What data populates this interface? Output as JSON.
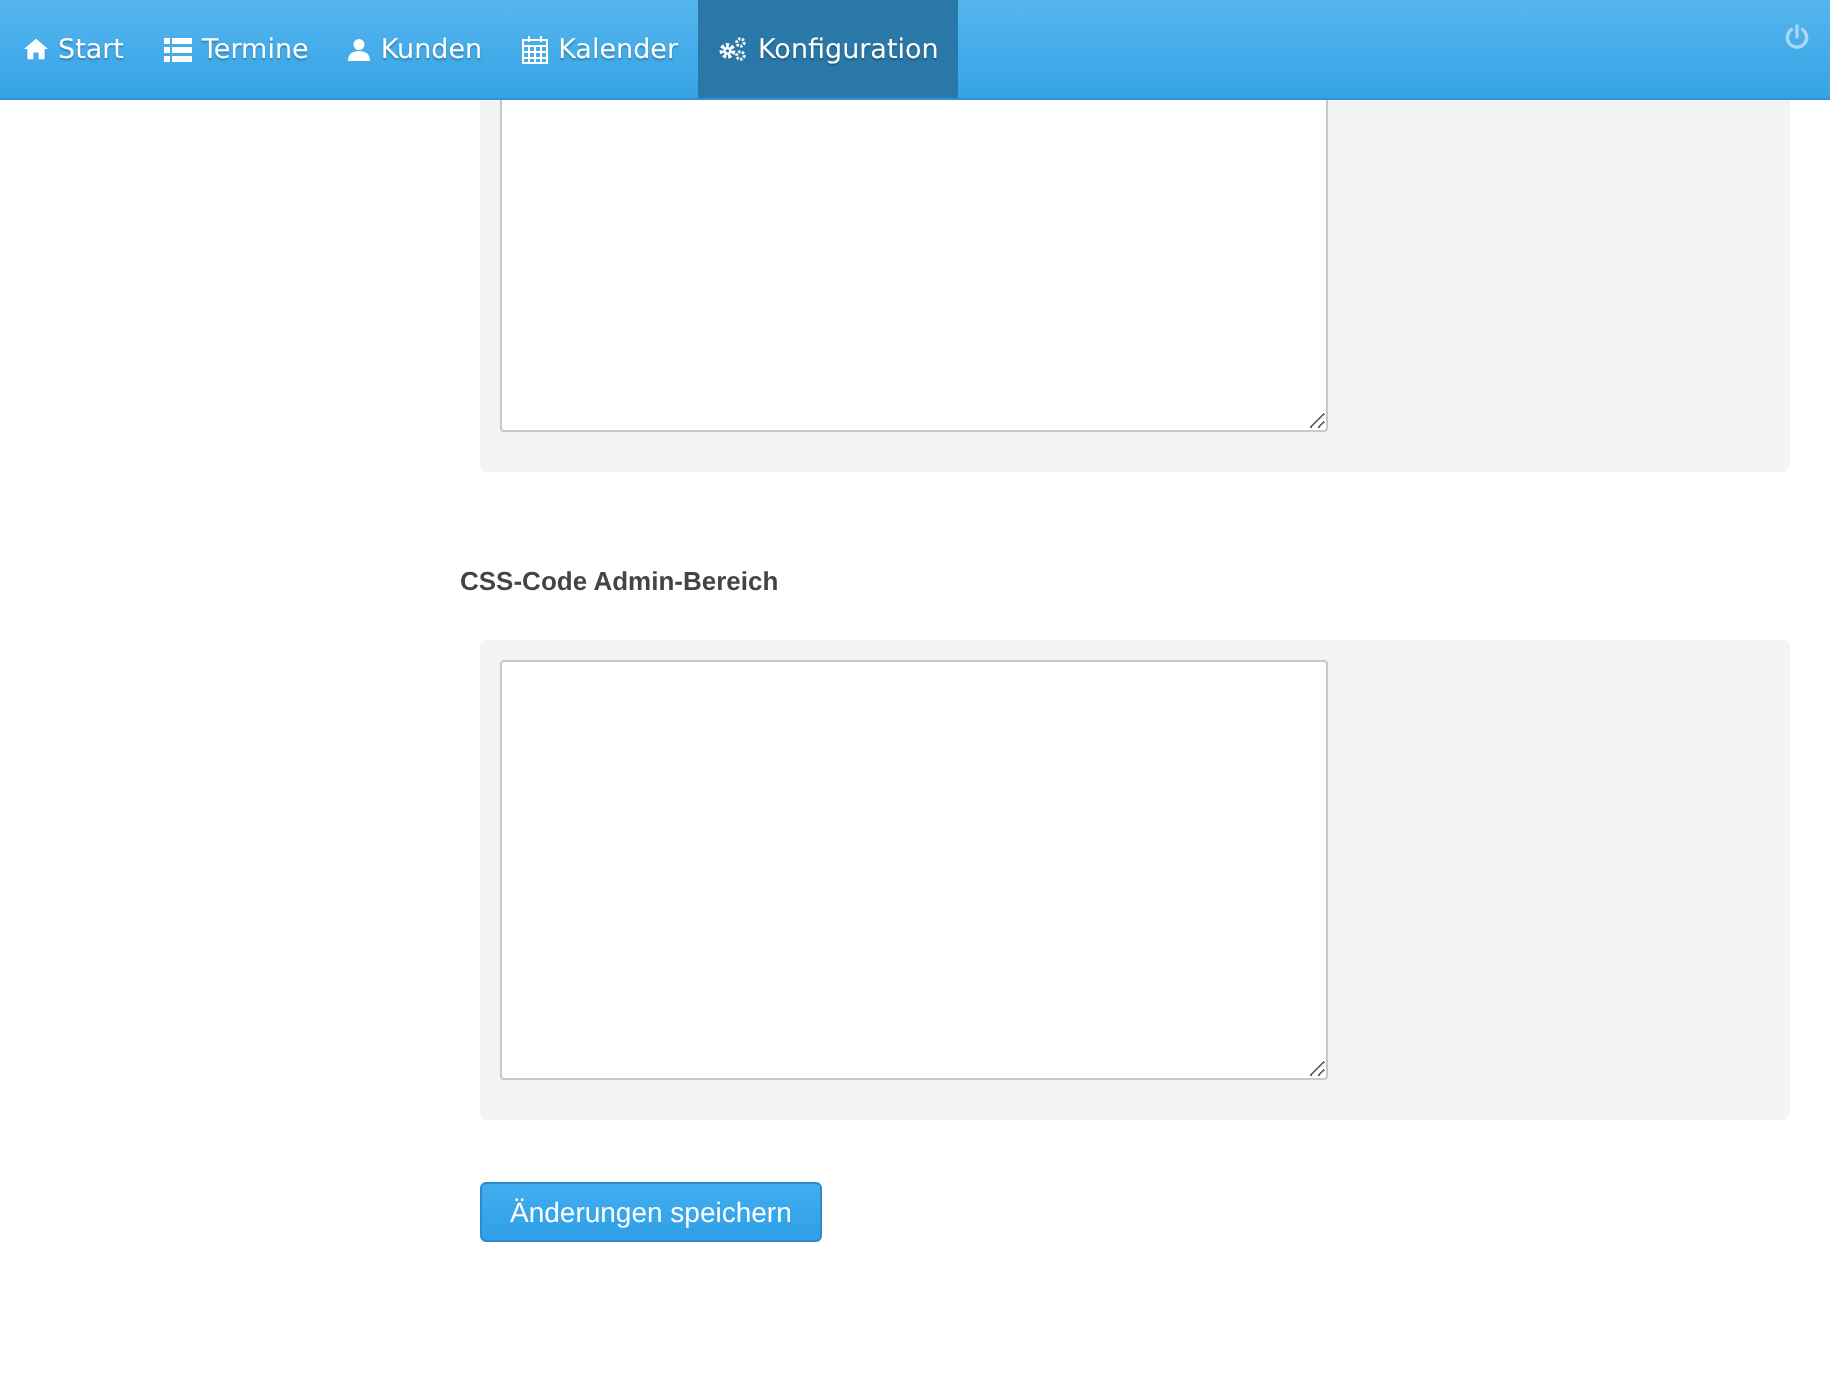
{
  "nav": {
    "items": [
      {
        "label": "Start",
        "kind": "home",
        "selected": false
      },
      {
        "label": "Termine",
        "kind": "list",
        "selected": false
      },
      {
        "label": "Kunden",
        "kind": "user",
        "selected": false
      },
      {
        "label": "Kalender",
        "kind": "calendar",
        "selected": false
      },
      {
        "label": "Konfiguration",
        "kind": "gears",
        "selected": true
      }
    ]
  },
  "sections": [
    {
      "kind": "cut"
    },
    {
      "kind": "full",
      "heading": "CSS-Code Admin-Bereich"
    }
  ],
  "save_button": "Änderungen speichern"
}
